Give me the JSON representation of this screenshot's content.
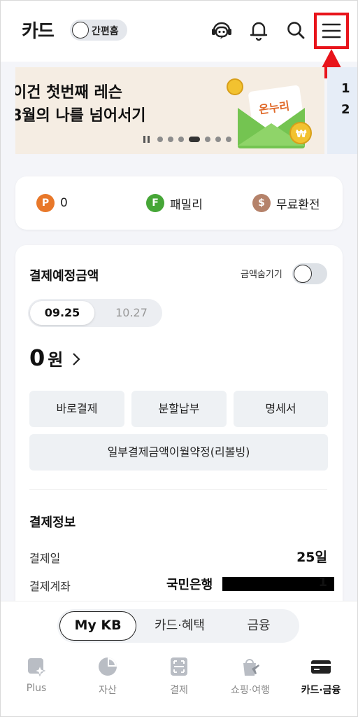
{
  "header": {
    "title": "카드",
    "simple_home_label": "간편홈"
  },
  "banner": {
    "line1": "이건 첫번째 레슨",
    "line2": "8월의 나를 넘어서기",
    "next_preview_chars": [
      "1",
      "2"
    ],
    "slide_count": 6,
    "active_slide": 4
  },
  "points": {
    "items": [
      {
        "badge": "P",
        "label": "0",
        "color": "#e8782a"
      },
      {
        "badge": "F",
        "label": "패밀리",
        "color": "#46a637"
      },
      {
        "badge": "$",
        "label": "무료환전",
        "color": "#b5826a"
      }
    ]
  },
  "payment": {
    "title": "결제예정금액",
    "hide_label": "금액숨기기",
    "dates": [
      "09.25",
      "10.27"
    ],
    "amount_number": "0",
    "amount_unit": "원",
    "buttons": [
      "바로결제",
      "분할납부",
      "명세서"
    ],
    "revolving_button": "일부결제금액이월약정(리볼빙)"
  },
  "payment_info": {
    "title": "결제정보",
    "date_label": "결제일",
    "date_value": "25일",
    "account_label": "결제계좌",
    "bank": "국민은행",
    "account_tail": "1"
  },
  "bottom_nav": {
    "segments": [
      "My KB",
      "카드·혜택",
      "금융"
    ],
    "tabs": [
      "Plus",
      "자산",
      "결제",
      "쇼핑·여행",
      "카드·금융"
    ]
  },
  "colors": {
    "highlight": "#e8141b",
    "banner_bg": "#f5ede3"
  }
}
